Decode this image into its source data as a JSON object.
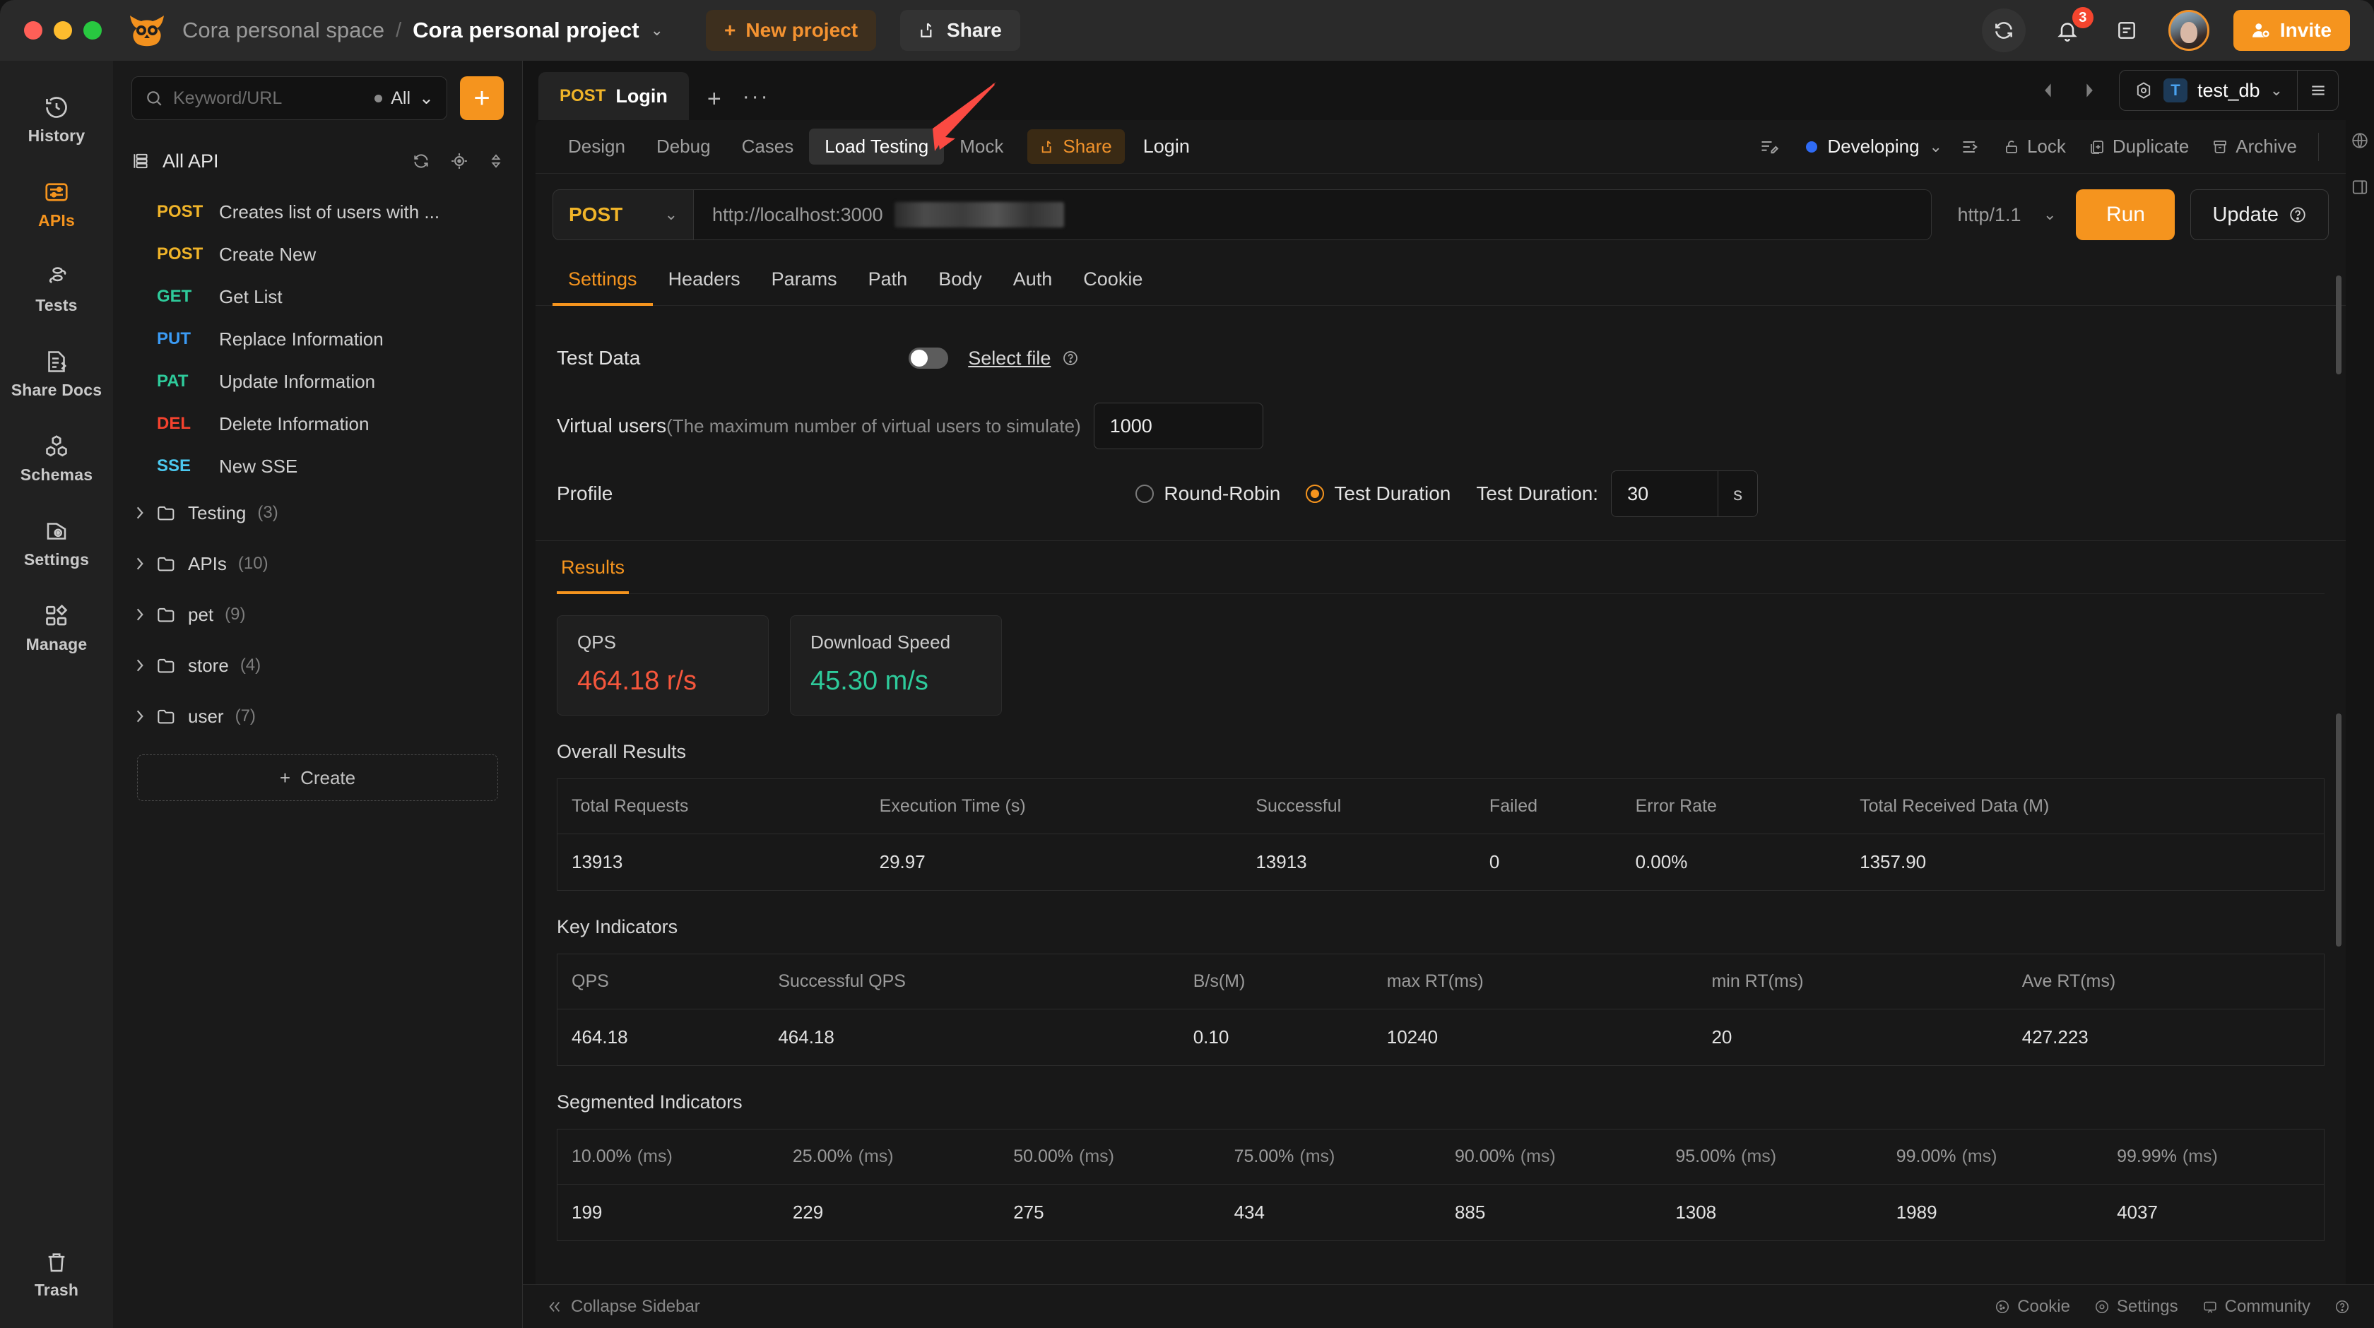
{
  "titlebar": {
    "space_name": "Cora personal space",
    "separator": "/",
    "project_name": "Cora personal project",
    "new_project_label": "New project",
    "share_label": "Share",
    "notification_count": "3",
    "invite_label": "Invite",
    "accent_color": "#f5941e"
  },
  "rail": {
    "items": [
      {
        "label": "History",
        "icon": "history-icon",
        "active": false
      },
      {
        "label": "APIs",
        "icon": "apis-icon",
        "active": true
      },
      {
        "label": "Tests",
        "icon": "tests-icon",
        "active": false
      },
      {
        "label": "Share Docs",
        "icon": "share-docs-icon",
        "active": false
      },
      {
        "label": "Schemas",
        "icon": "schemas-icon",
        "active": false
      },
      {
        "label": "Settings",
        "icon": "settings-icon",
        "active": false
      },
      {
        "label": "Manage",
        "icon": "manage-icon",
        "active": false
      }
    ],
    "trash_label": "Trash"
  },
  "sidebar": {
    "search_placeholder": "Keyword/URL",
    "filter_label": "All",
    "all_api_label": "All API",
    "apis": [
      {
        "method": "POST",
        "cls": "post",
        "name": "Creates list of users with ..."
      },
      {
        "method": "POST",
        "cls": "post",
        "name": "Create New"
      },
      {
        "method": "GET",
        "cls": "get",
        "name": "Get List"
      },
      {
        "method": "PUT",
        "cls": "put",
        "name": "Replace Information"
      },
      {
        "method": "PAT",
        "cls": "pat",
        "name": "Update Information"
      },
      {
        "method": "DEL",
        "cls": "del",
        "name": "Delete Information"
      },
      {
        "method": "SSE",
        "cls": "sse",
        "name": "New SSE"
      }
    ],
    "folders": [
      {
        "name": "Testing",
        "count": "(3)"
      },
      {
        "name": "APIs",
        "count": "(10)"
      },
      {
        "name": "pet",
        "count": "(9)"
      },
      {
        "name": "store",
        "count": "(4)"
      },
      {
        "name": "user",
        "count": "(7)"
      }
    ],
    "create_label": "Create"
  },
  "main": {
    "doc_tab": {
      "method": "POST",
      "title": "Login"
    },
    "env": {
      "badge": "T",
      "name": "test_db"
    },
    "subtabs": [
      {
        "label": "Design",
        "active": false
      },
      {
        "label": "Debug",
        "active": false
      },
      {
        "label": "Cases",
        "active": false
      },
      {
        "label": "Load Testing",
        "active": true
      },
      {
        "label": "Mock",
        "active": false
      }
    ],
    "share_chip_label": "Share",
    "api_title": "Login",
    "status_label": "Developing",
    "status_color": "#2f6bf5",
    "actions": [
      {
        "label": "Lock",
        "icon": "lock-icon"
      },
      {
        "label": "Duplicate",
        "icon": "duplicate-icon"
      },
      {
        "label": "Archive",
        "icon": "archive-icon"
      }
    ],
    "request": {
      "method": "POST",
      "url": "http://localhost:3000",
      "protocol": "http/1.1",
      "run_label": "Run",
      "update_label": "Update"
    },
    "request_tabs": [
      {
        "label": "Settings",
        "active": true
      },
      {
        "label": "Headers",
        "active": false
      },
      {
        "label": "Params",
        "active": false
      },
      {
        "label": "Path",
        "active": false
      },
      {
        "label": "Body",
        "active": false
      },
      {
        "label": "Auth",
        "active": false
      },
      {
        "label": "Cookie",
        "active": false
      }
    ]
  },
  "settings": {
    "test_data_label": "Test Data",
    "test_data_enabled": false,
    "select_file_label": "Select file",
    "virtual_users_label": "Virtual users",
    "virtual_users_hint": "(The maximum number of virtual users to simulate)",
    "virtual_users_value": "1000",
    "profile_label": "Profile",
    "profile_options": [
      {
        "label": "Round-Robin",
        "selected": false
      },
      {
        "label": "Test Duration",
        "selected": true
      }
    ],
    "duration_label": "Test Duration:",
    "duration_value": "30",
    "duration_unit": "s"
  },
  "results": {
    "tab_label": "Results",
    "cards": [
      {
        "title": "QPS",
        "value": "464.18 r/s",
        "color": "red"
      },
      {
        "title": "Download Speed",
        "value": "45.30 m/s",
        "color": "teal"
      }
    ],
    "overall": {
      "title": "Overall Results",
      "headers": [
        "Total Requests",
        "Execution Time (s)",
        "Successful",
        "Failed",
        "Error Rate",
        "Total Received Data (M)"
      ],
      "row": [
        "13913",
        "29.97",
        "13913",
        "0",
        "0.00%",
        "1357.90"
      ]
    },
    "key_indicators": {
      "title": "Key Indicators",
      "headers": [
        "QPS",
        "Successful QPS",
        "B/s(M)",
        "max RT(ms)",
        "min RT(ms)",
        "Ave RT(ms)"
      ],
      "row": [
        "464.18",
        "464.18",
        "0.10",
        "10240",
        "20",
        "427.223"
      ]
    },
    "segmented": {
      "title": "Segmented Indicators",
      "headers": [
        {
          "pct": "10.00%",
          "unit": "(ms)"
        },
        {
          "pct": "25.00%",
          "unit": "(ms)"
        },
        {
          "pct": "50.00%",
          "unit": "(ms)"
        },
        {
          "pct": "75.00%",
          "unit": "(ms)"
        },
        {
          "pct": "90.00%",
          "unit": "(ms)"
        },
        {
          "pct": "95.00%",
          "unit": "(ms)"
        },
        {
          "pct": "99.00%",
          "unit": "(ms)"
        },
        {
          "pct": "99.99%",
          "unit": "(ms)"
        }
      ],
      "row": [
        "199",
        "229",
        "275",
        "434",
        "885",
        "1308",
        "1989",
        "4037"
      ]
    }
  },
  "statusbar": {
    "collapse_label": "Collapse Sidebar",
    "items": [
      {
        "label": "Cookie",
        "icon": "cookie-icon"
      },
      {
        "label": "Settings",
        "icon": "gear-icon"
      },
      {
        "label": "Community",
        "icon": "community-icon"
      }
    ]
  }
}
